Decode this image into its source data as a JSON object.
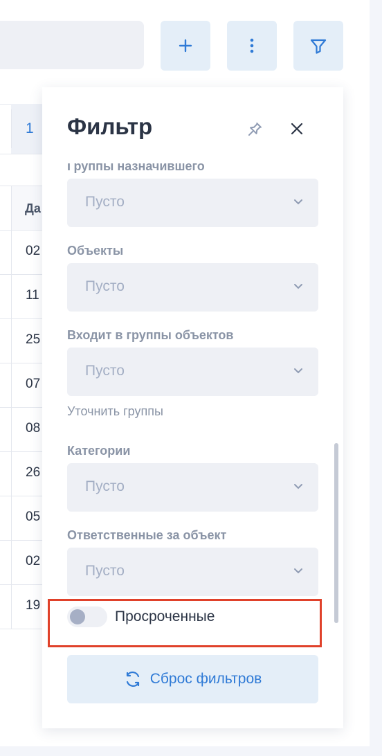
{
  "toolbar": {
    "add_icon": "plus-icon",
    "more_icon": "vertical-dots-icon",
    "filter_icon": "funnel-icon"
  },
  "background": {
    "pager_number": "1",
    "column_header": "Да",
    "rows": [
      "02",
      "11",
      "25",
      "07",
      "08",
      "26",
      "05",
      "02",
      "19"
    ]
  },
  "filter_panel": {
    "title": "Фильтр",
    "pin_icon": "pin-icon",
    "close_icon": "close-icon",
    "partial_label": "Группы назначившего",
    "fields": [
      {
        "label": "Объекты",
        "value": "Пусто"
      },
      {
        "label": "Входит в группы объектов",
        "value": "Пусто"
      },
      {
        "label": "Категории",
        "value": "Пусто"
      },
      {
        "label": "Ответственные за объект",
        "value": "Пусто"
      }
    ],
    "first_select_value": "Пусто",
    "refine_groups_link": "Уточнить группы",
    "overdue_toggle": {
      "label": "Просроченные",
      "checked": false
    },
    "reset_button": "Сброс фильтров"
  },
  "colors": {
    "accent": "#2f7ad6",
    "highlight_border": "#e0412a",
    "select_bg": "#eef0f5",
    "button_bg": "#e4eef8"
  }
}
